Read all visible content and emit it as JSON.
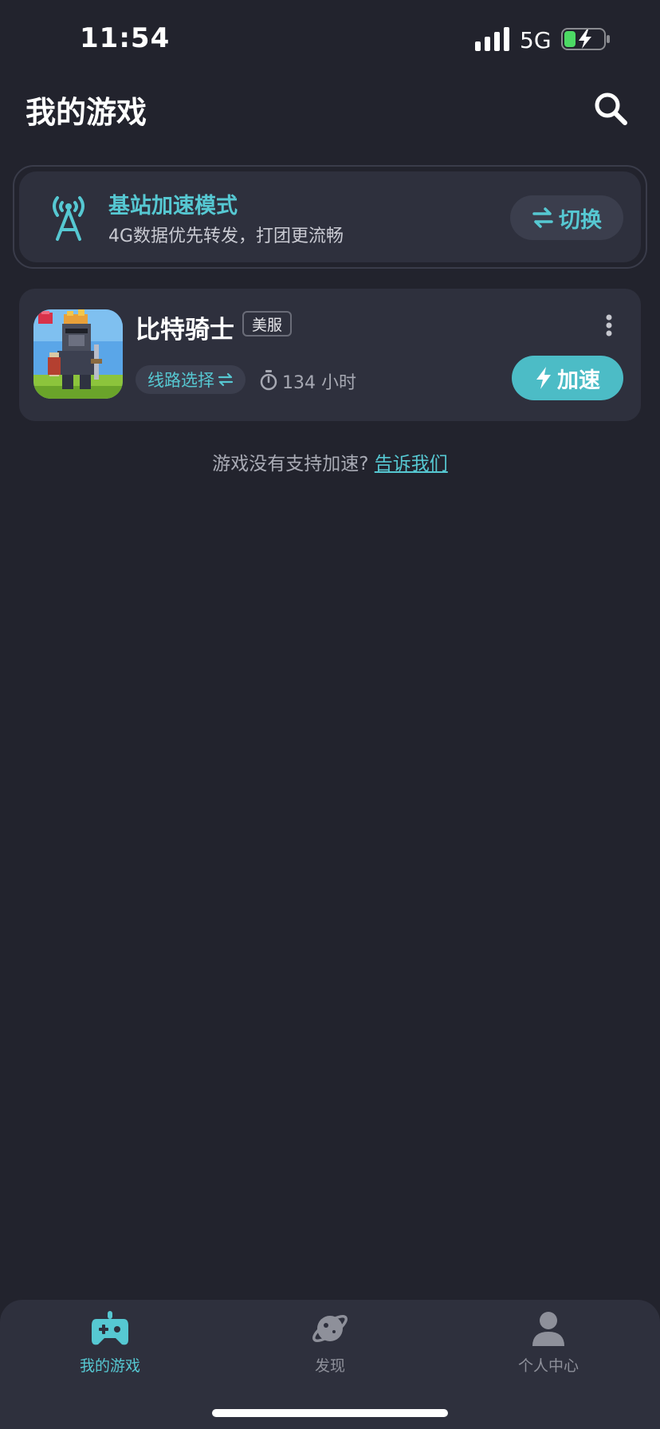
{
  "status_bar": {
    "time": "11:54",
    "network": "5G",
    "icons": [
      "signal-icon",
      "battery-charging-icon"
    ]
  },
  "header": {
    "title": "我的游戏",
    "search_icon": "search-icon"
  },
  "mode_card": {
    "icon": "cell-tower-icon",
    "title": "基站加速模式",
    "description": "4G数据优先转发，打团更流畅",
    "switch_label": "切换"
  },
  "game": {
    "name": "比特骑士",
    "region": "美服",
    "route_label": "线路选择",
    "playtime": "134 小时",
    "boost_label": "加速",
    "icon": "game-icon-bit-heroes"
  },
  "hint": {
    "text": "游戏没有支持加速?",
    "link": "告诉我们"
  },
  "tabs": [
    {
      "label": "我的游戏",
      "icon": "gamepad-icon",
      "active": true
    },
    {
      "label": "发现",
      "icon": "planet-icon",
      "active": false
    },
    {
      "label": "个人中心",
      "icon": "user-icon",
      "active": false
    }
  ],
  "colors": {
    "background": "#22232d",
    "card": "#2e303d",
    "accent": "#56c8d2",
    "boost_button": "#4cbcc6"
  }
}
